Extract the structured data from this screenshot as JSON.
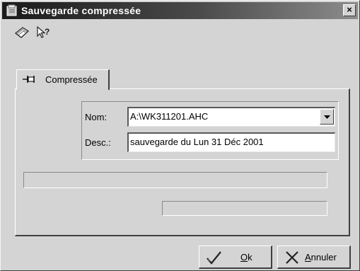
{
  "window": {
    "title": "Sauvegarde compressée",
    "close_label": "×"
  },
  "toolbar": {
    "icons": [
      "notebook-icon",
      "help-pointer-icon"
    ]
  },
  "tabs": [
    {
      "label": "Compressée",
      "icon": "pushpin-icon",
      "active": true
    }
  ],
  "form": {
    "name_label": "Nom:",
    "name_value": "A:\\WK311201.AHC",
    "desc_label": "Desc.:",
    "desc_value": "sauvegarde du Lun 31 Déc 2001"
  },
  "progress": {
    "main": 0,
    "secondary": 0
  },
  "buttons": {
    "ok_first": "O",
    "ok_rest": "k",
    "cancel_first": "A",
    "cancel_rest": "nnuler"
  }
}
